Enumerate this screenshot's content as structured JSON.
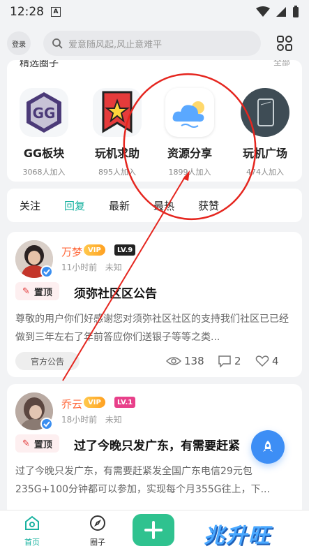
{
  "status_bar": {
    "time": "12:28",
    "badge": "A"
  },
  "header": {
    "login_label": "登录",
    "search_placeholder": "爱意随风起,风止意难平"
  },
  "circles": {
    "title": "精选圈子",
    "more": "全部",
    "items": [
      {
        "name": "GG板块",
        "count": "3068人加入",
        "icon": "gg-app-icon"
      },
      {
        "name": "玩机求助",
        "count": "895人加入",
        "icon": "star-bookmark-icon"
      },
      {
        "name": "资源分享",
        "count": "1899人加入",
        "icon": "cloud-icon"
      },
      {
        "name": "玩机广场",
        "count": "474人加入",
        "icon": "phone-icon"
      }
    ]
  },
  "tabs": [
    {
      "label": "关注",
      "active": false
    },
    {
      "label": "回复",
      "active": true
    },
    {
      "label": "最新",
      "active": false
    },
    {
      "label": "最热",
      "active": false
    },
    {
      "label": "获赞",
      "active": false
    }
  ],
  "posts": [
    {
      "username": "万梦",
      "vip": "VIP",
      "level": "LV.9",
      "time": "11小时前",
      "location": "未知",
      "pin_label": "置顶",
      "title": "须弥社区区公告",
      "excerpt": "尊敬的用户你们好感谢您对须弥社区社区的支持我们社区已已经做到三年左右了年前答应你们送银子等等之类...",
      "tag": "官方公告",
      "views": "138",
      "comments": "2",
      "likes": "4"
    },
    {
      "username": "乔云",
      "vip": "VIP",
      "level": "LV.1",
      "time": "18小时前",
      "location": "未知",
      "pin_label": "置顶",
      "title": "过了今晚只发广东，有需要赶紧",
      "excerpt": "过了今晚只发广东，有需要赶紧发全国广东电信29元包235G+100分钟都可以参加，实现每个月355G往上，下..."
    }
  ],
  "bottom_nav": {
    "home": "首页",
    "circle": "圈子"
  },
  "watermark": "兆升旺",
  "colors": {
    "accent": "#19b2a0",
    "username": "#ff6a3d",
    "fab": "#3d8ef5",
    "plus": "#2fc28f",
    "annotation": "#e5261f"
  }
}
